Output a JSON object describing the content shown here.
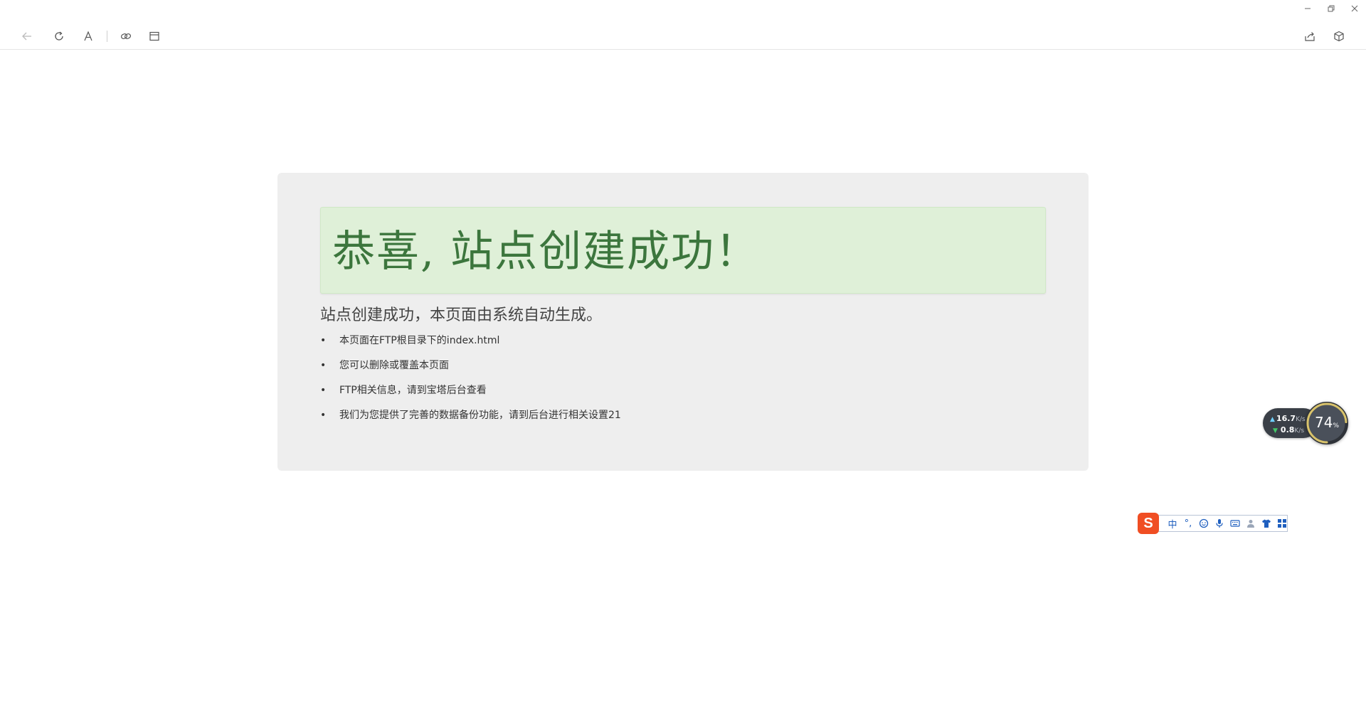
{
  "window": {
    "controls": [
      {
        "name": "minimize-icon"
      },
      {
        "name": "restore-icon"
      },
      {
        "name": "close-icon"
      }
    ]
  },
  "toolbar": {
    "left_icons": [
      "back-arrow-icon",
      "refresh-icon",
      "font-icon",
      "link-icon",
      "layout-icon"
    ],
    "right_icons": [
      "share-icon",
      "cube-icon"
    ]
  },
  "page": {
    "headline": "恭喜, 站点创建成功！",
    "lead": "站点创建成功，本页面由系统自动生成。",
    "items": [
      "本页面在FTP根目录下的index.html",
      "您可以删除或覆盖本页面",
      "FTP相关信息，请到宝塔后台查看",
      "我们为您提供了完善的数据备份功能，请到后台进行相关设置21"
    ]
  },
  "net_widget": {
    "upload_value": "16.7",
    "upload_unit": "K/s",
    "download_value": "0.8",
    "download_unit": "K/s",
    "percent": "74",
    "percent_symbol": "%",
    "percent_fraction": 0.74
  },
  "ime": {
    "logo": "S",
    "mode_label": "中",
    "punct_label": "°,",
    "items": [
      "emoji-icon",
      "microphone-icon",
      "keyboard-icon",
      "user-icon",
      "skin-icon",
      "toolbox-icon"
    ]
  },
  "colors": {
    "alert_bg": "#dff0d8",
    "alert_text": "#3c763d",
    "card_bg": "#eeeeee",
    "ime_blue": "#1f5fbf",
    "ime_logo": "#f04e23"
  }
}
